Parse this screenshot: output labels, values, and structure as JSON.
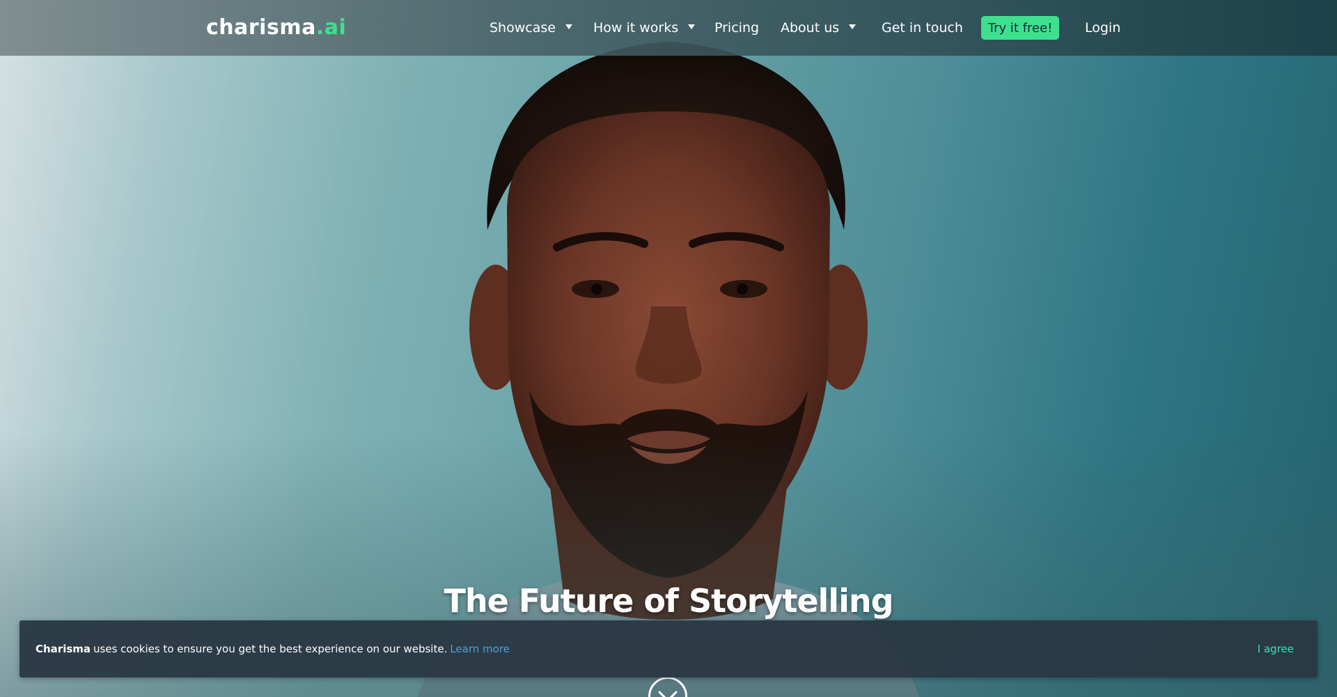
{
  "header": {
    "logo_main": "charisma",
    "logo_accent": ".ai",
    "nav": [
      {
        "label": "Showcase",
        "has_dropdown": true
      },
      {
        "label": "How it works",
        "has_dropdown": true
      },
      {
        "label": "Pricing",
        "has_dropdown": false
      },
      {
        "label": "About us",
        "has_dropdown": true
      },
      {
        "label": "Get in touch",
        "has_dropdown": false
      }
    ],
    "cta_label": "Try it free!",
    "login_label": "Login"
  },
  "hero": {
    "headline": "The Future of Storytelling",
    "image": "portrait-of-man"
  },
  "cookie_banner": {
    "brand": "Charisma",
    "message": "uses cookies to ensure you get the best experience on our website.",
    "learn_more": "Learn more",
    "agree": "I agree"
  },
  "colors": {
    "accent": "#3ee08f",
    "link": "#4fa3d8",
    "banner_bg": "#2a3844"
  }
}
